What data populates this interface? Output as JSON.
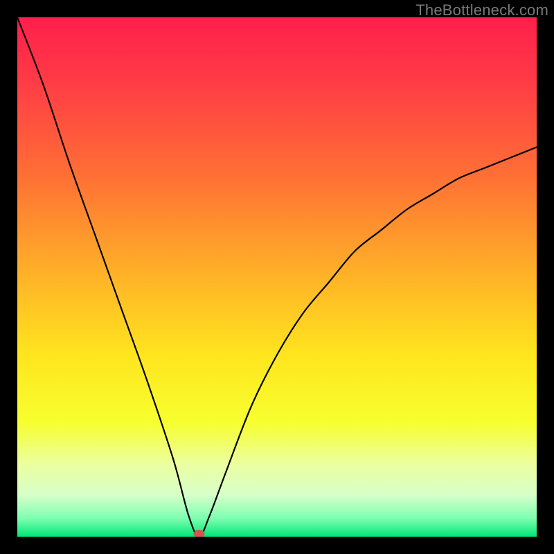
{
  "watermark": "TheBottleneck.com",
  "chart_data": {
    "type": "line",
    "title": "",
    "xlabel": "",
    "ylabel": "",
    "xlim": [
      0,
      100
    ],
    "ylim": [
      0,
      100
    ],
    "grid": false,
    "notes": "Gradient-background bottleneck curve. Red (top) → yellow (middle) → green (bottom). A single black curve plunges from top-left to a minimum near x≈35, y≈0, with a small red marker at the minimum, then rises toward the right edge. No axis ticks or labels visible.",
    "series": [
      {
        "name": "bottleneck-curve",
        "x": [
          0,
          5,
          10,
          15,
          20,
          25,
          30,
          33,
          35,
          37,
          40,
          45,
          50,
          55,
          60,
          65,
          70,
          75,
          80,
          85,
          90,
          95,
          100
        ],
        "y": [
          100,
          87,
          72,
          58,
          44,
          30,
          15,
          4,
          0,
          4,
          12,
          25,
          35,
          43,
          49,
          55,
          59,
          63,
          66,
          69,
          71,
          73,
          75
        ]
      }
    ],
    "marker": {
      "x": 35,
      "y": 0,
      "color": "#d4554f"
    },
    "gradient_stops": [
      {
        "offset": 0.0,
        "color": "#ff1f4b"
      },
      {
        "offset": 0.12,
        "color": "#ff3a46"
      },
      {
        "offset": 0.3,
        "color": "#ff6e35"
      },
      {
        "offset": 0.5,
        "color": "#ffb327"
      },
      {
        "offset": 0.65,
        "color": "#ffe51e"
      },
      {
        "offset": 0.78,
        "color": "#f7ff2f"
      },
      {
        "offset": 0.86,
        "color": "#ecffa0"
      },
      {
        "offset": 0.92,
        "color": "#d7ffc9"
      },
      {
        "offset": 0.965,
        "color": "#7cffb0"
      },
      {
        "offset": 1.0,
        "color": "#00e676"
      }
    ]
  }
}
